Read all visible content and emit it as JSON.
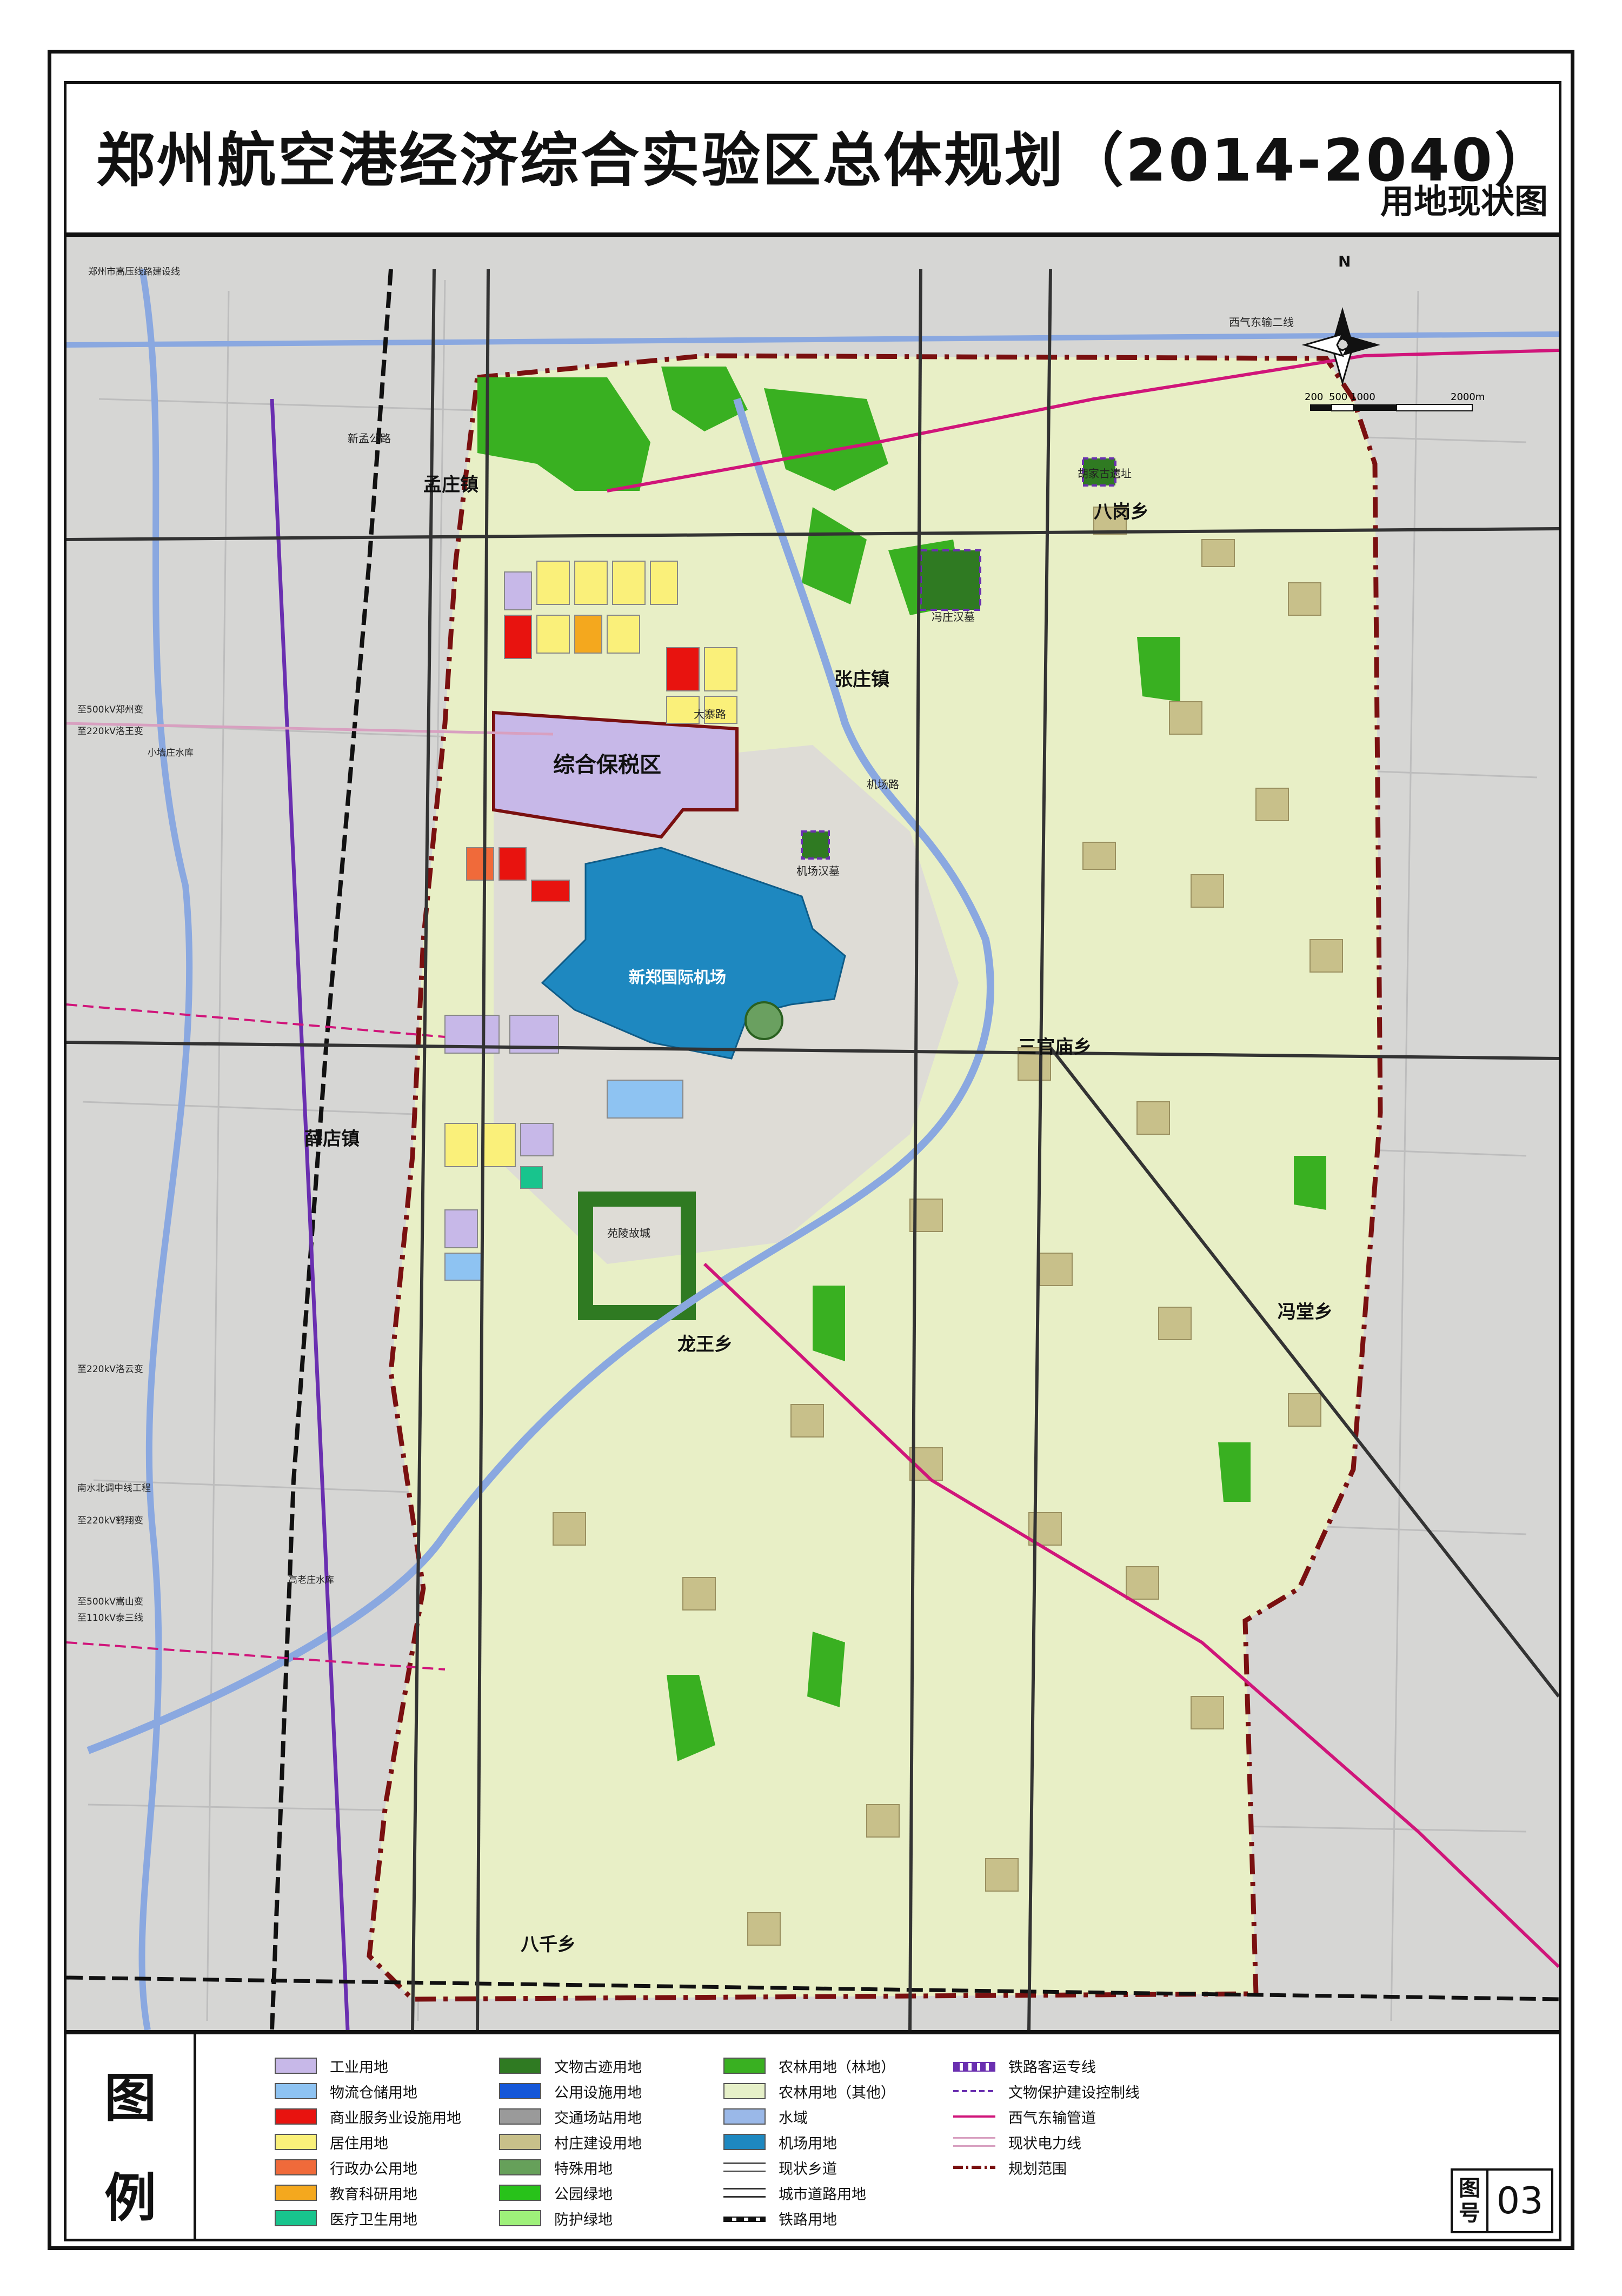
{
  "title": "郑州航空港经济综合实验区总体规划（2014-2040）",
  "subtitle": "用地现状图",
  "map": {
    "north_label": "N",
    "scale_labels": [
      "200",
      "500",
      "1000",
      "2000m"
    ],
    "place_labels": {
      "mengzhuang": "孟庄镇",
      "zhangzhuang": "张庄镇",
      "bagang": "八岗乡",
      "sanguanmiao": "三官庙乡",
      "xuedian": "薛店镇",
      "longwang": "龙王乡",
      "fengtang": "冯堂乡",
      "baqian": "八千乡",
      "bonded_zone": "综合保税区",
      "airport": "新郑国际机场",
      "airport_relics": "机场汉墓",
      "fengzhuang_relics": "冯庄汉墓",
      "gaoling_relics": "苑陵故城",
      "bagang_relics": "胡家古遗址"
    },
    "road_labels": {
      "west_east_gas": "西气东输二线",
      "new_mengzhuang": "新孟公路",
      "airport_ring": "机场路",
      "dazhai": "大寨路"
    },
    "left_annotations": [
      "郑州市高压线路建设线",
      "至500kV郑州变",
      "至220kV洛王变",
      "小墙庄水库",
      "至220kV洛云变",
      "南水北调中线工程",
      "至220kV鹤翔变",
      "至500kV嵩山变",
      "至110kV泰三线",
      "高老庄水库"
    ]
  },
  "legend": {
    "title_top": "图",
    "title_bottom": "例",
    "items": [
      {
        "label": "工业用地",
        "color": "#c7b8e8",
        "type": "fill"
      },
      {
        "label": "物流仓储用地",
        "color": "#8ec3f2",
        "type": "fill"
      },
      {
        "label": "商业服务业设施用地",
        "color": "#e8130f",
        "type": "fill"
      },
      {
        "label": "居住用地",
        "color": "#faf07a",
        "type": "fill"
      },
      {
        "label": "行政办公用地",
        "color": "#f06a3a",
        "type": "fill"
      },
      {
        "label": "教育科研用地",
        "color": "#f4a81e",
        "type": "fill"
      },
      {
        "label": "医疗卫生用地",
        "color": "#18c48d",
        "type": "fill"
      },
      {
        "label": "文物古迹用地",
        "color": "#2f7a22",
        "type": "fill"
      },
      {
        "label": "公用设施用地",
        "color": "#1557d8",
        "type": "fill"
      },
      {
        "label": "交通场站用地",
        "color": "#9a9a9a",
        "type": "fill"
      },
      {
        "label": "村庄建设用地",
        "color": "#c8c08a",
        "type": "fill"
      },
      {
        "label": "特殊用地",
        "color": "#66a05a",
        "type": "fill"
      },
      {
        "label": "公园绿地",
        "color": "#28c21a",
        "type": "fill"
      },
      {
        "label": "防护绿地",
        "color": "#9ef07a",
        "type": "fill"
      },
      {
        "label": "农林用地（林地）",
        "color": "#39b021",
        "type": "fill"
      },
      {
        "label": "农林用地（其他）",
        "color": "#e6f0c8",
        "type": "fill"
      },
      {
        "label": "水域",
        "color": "#9ab8e8",
        "type": "fill"
      },
      {
        "label": "机场用地",
        "color": "#1e88c0",
        "type": "fill"
      },
      {
        "label": "现状乡道",
        "color": "#555555",
        "type": "double-line"
      },
      {
        "label": "城市道路用地",
        "color": "#333333",
        "type": "double-line"
      },
      {
        "label": "铁路用地",
        "color": "#111111",
        "type": "rail"
      },
      {
        "label": "铁路客运专线",
        "color": "#6a2fb0",
        "type": "hsr"
      },
      {
        "label": "文物保护建设控制线",
        "color": "#6a2fb0",
        "type": "dashed"
      },
      {
        "label": "西气东输管道",
        "color": "#d0157a",
        "type": "line"
      },
      {
        "label": "现状电力线",
        "color": "#d8a0c0",
        "type": "double-line"
      },
      {
        "label": "规划范围",
        "color": "#7a1010",
        "type": "dashdot"
      }
    ]
  },
  "figure_number": {
    "label": "图号",
    "number": "03"
  }
}
